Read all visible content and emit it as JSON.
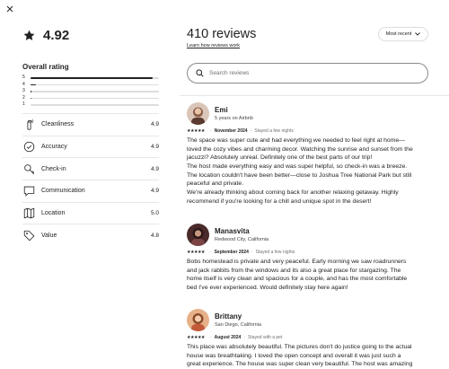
{
  "header": {
    "close_icon": "close-icon"
  },
  "summary": {
    "score": "4.92",
    "star_icon": "star-icon",
    "overall_title": "Overall rating",
    "distribution": [
      {
        "label": "5",
        "fraction": 0.95
      },
      {
        "label": "4",
        "fraction": 0.04
      },
      {
        "label": "3",
        "fraction": 0.01
      },
      {
        "label": "2",
        "fraction": 0.005
      },
      {
        "label": "1",
        "fraction": 0.0
      }
    ],
    "categories": [
      {
        "label": "Cleanliness",
        "value": "4.9",
        "icon": "spray-bottle-icon"
      },
      {
        "label": "Accuracy",
        "value": "4.9",
        "icon": "check-circle-icon"
      },
      {
        "label": "Check-in",
        "value": "4.9",
        "icon": "key-icon"
      },
      {
        "label": "Communication",
        "value": "4.9",
        "icon": "message-bubble-icon"
      },
      {
        "label": "Location",
        "value": "5.0",
        "icon": "map-icon"
      },
      {
        "label": "Value",
        "value": "4.8",
        "icon": "price-tag-icon"
      }
    ]
  },
  "reviews_panel": {
    "count_label": "410 reviews",
    "learn_link": "Learn how reviews work",
    "sort_label": "Most recent",
    "search_placeholder": "Search reviews"
  },
  "reviews": [
    {
      "name": "Emi",
      "sub": "5 years on Airbnb",
      "stars": "★★★★★",
      "date": "November 2024",
      "stay": "Stayed a few nights",
      "text": "The space was super cute and had everything we needed to feel right at home—\nloved the cozy vibes and charming decor. Watching the sunrise and sunset from the\njacuzzi? Absolutely unreal. Definitely one of the best parts of our trip!\nThe host made everything easy and was super helpful, so check-in was a breeze.\nThe location couldn't have been better—close to Joshua Tree National Park but still\npeaceful and private.\nWe're already thinking about coming back for another relaxing getaway. Highly\nrecommend if you're looking for a chill and unique spot in the desert!",
      "avatar_color": "#b08a78"
    },
    {
      "name": "Manasvita",
      "sub": "Redwood City, California",
      "stars": "★★★★★",
      "date": "September 2024",
      "stay": "Stayed a few nights",
      "text": "Bobs homestead is private and very peaceful. Early morning we saw roadrunners\nand jack rabbits from the windows and its also a great place for stargazing. The\nhome itself is very clean and spacious for a couple, and has the most comfortable\nbed I've ever experienced. Would definitely stay here again!",
      "avatar_color": "#6b3b3b"
    },
    {
      "name": "Brittany",
      "sub": "San Diego, California",
      "stars": "★★★★★",
      "date": "August 2024",
      "stay": "Stayed with a pet",
      "text": "This place was absolutely beautiful. The pictures don't do justice going to the actual\nhouse was breathtaking. I loved the open concept and overall it was just such a\ngreat experience. The house was super clean very beautiful. The host was amazing",
      "avatar_color": "#c9844f"
    }
  ]
}
